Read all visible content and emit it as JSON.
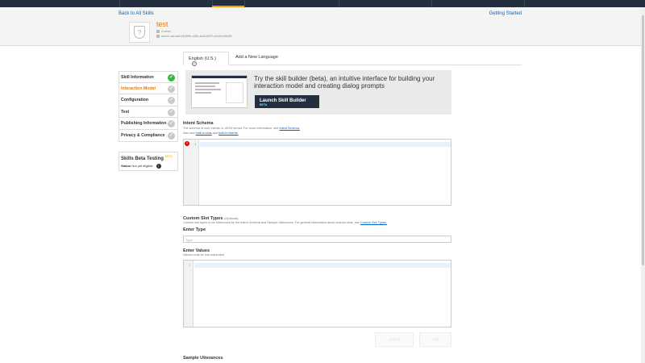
{
  "header": {
    "back_link": "Back to All Skills",
    "getting_started": "Getting Started",
    "skill_name": "test",
    "skill_type": "Custom",
    "skill_id": "amzn1.ask.skill.fd1f9f5e-a09b-4ba3-8997-b0c9f1a06489"
  },
  "language_tabs": {
    "current": "English (U.S.)",
    "add": "Add a New Language"
  },
  "sidebar": {
    "items": [
      {
        "label": "Skill Information",
        "status": "complete"
      },
      {
        "label": "Interaction Model",
        "status": "incomplete"
      },
      {
        "label": "Configuration",
        "status": "incomplete"
      },
      {
        "label": "Test",
        "status": "incomplete"
      },
      {
        "label": "Publishing Information",
        "status": "incomplete"
      },
      {
        "label": "Privacy & Compliance",
        "status": "incomplete"
      }
    ],
    "beta": {
      "title": "Skills Beta Testing",
      "badge": "BETA",
      "status_label": "Status",
      "status_value": "Not yet eligible"
    }
  },
  "promo": {
    "text": "Try the skill builder (beta), an intuitive interface for building your interaction model and creating dialog prompts",
    "button": "Launch Skill Builder",
    "button_badge": "BETA"
  },
  "intent_schema": {
    "title": "Intent Schema",
    "desc1": "The schema of user intents in JSON format. For more information, see",
    "desc1_link": "Intent Schema.",
    "desc2": "Also see",
    "desc2_link1": "built-in slots",
    "desc2_mid": "and",
    "desc2_link2": "built-in intents.",
    "line_number": "1"
  },
  "custom_slots": {
    "title": "Custom Slot Types",
    "optional": "(Optional)",
    "desc": "Custom slot types to be referenced by the Intent Schema and Sample Utterances. For general information about custom slots, see",
    "desc_link": "Custom Slot Types.",
    "enter_type_label": "Enter Type",
    "type_placeholder": "Type",
    "enter_values_label": "Enter Values",
    "values_desc": "Values must be line-separated",
    "line_number": "1",
    "cancel": "Cancel",
    "add": "Add"
  },
  "sample_utterances": {
    "title": "Sample Utterances"
  },
  "colors": {
    "accent": "#e47911",
    "link": "#0066c0",
    "topbar": "#232f3e",
    "complete": "#3bb54a"
  }
}
